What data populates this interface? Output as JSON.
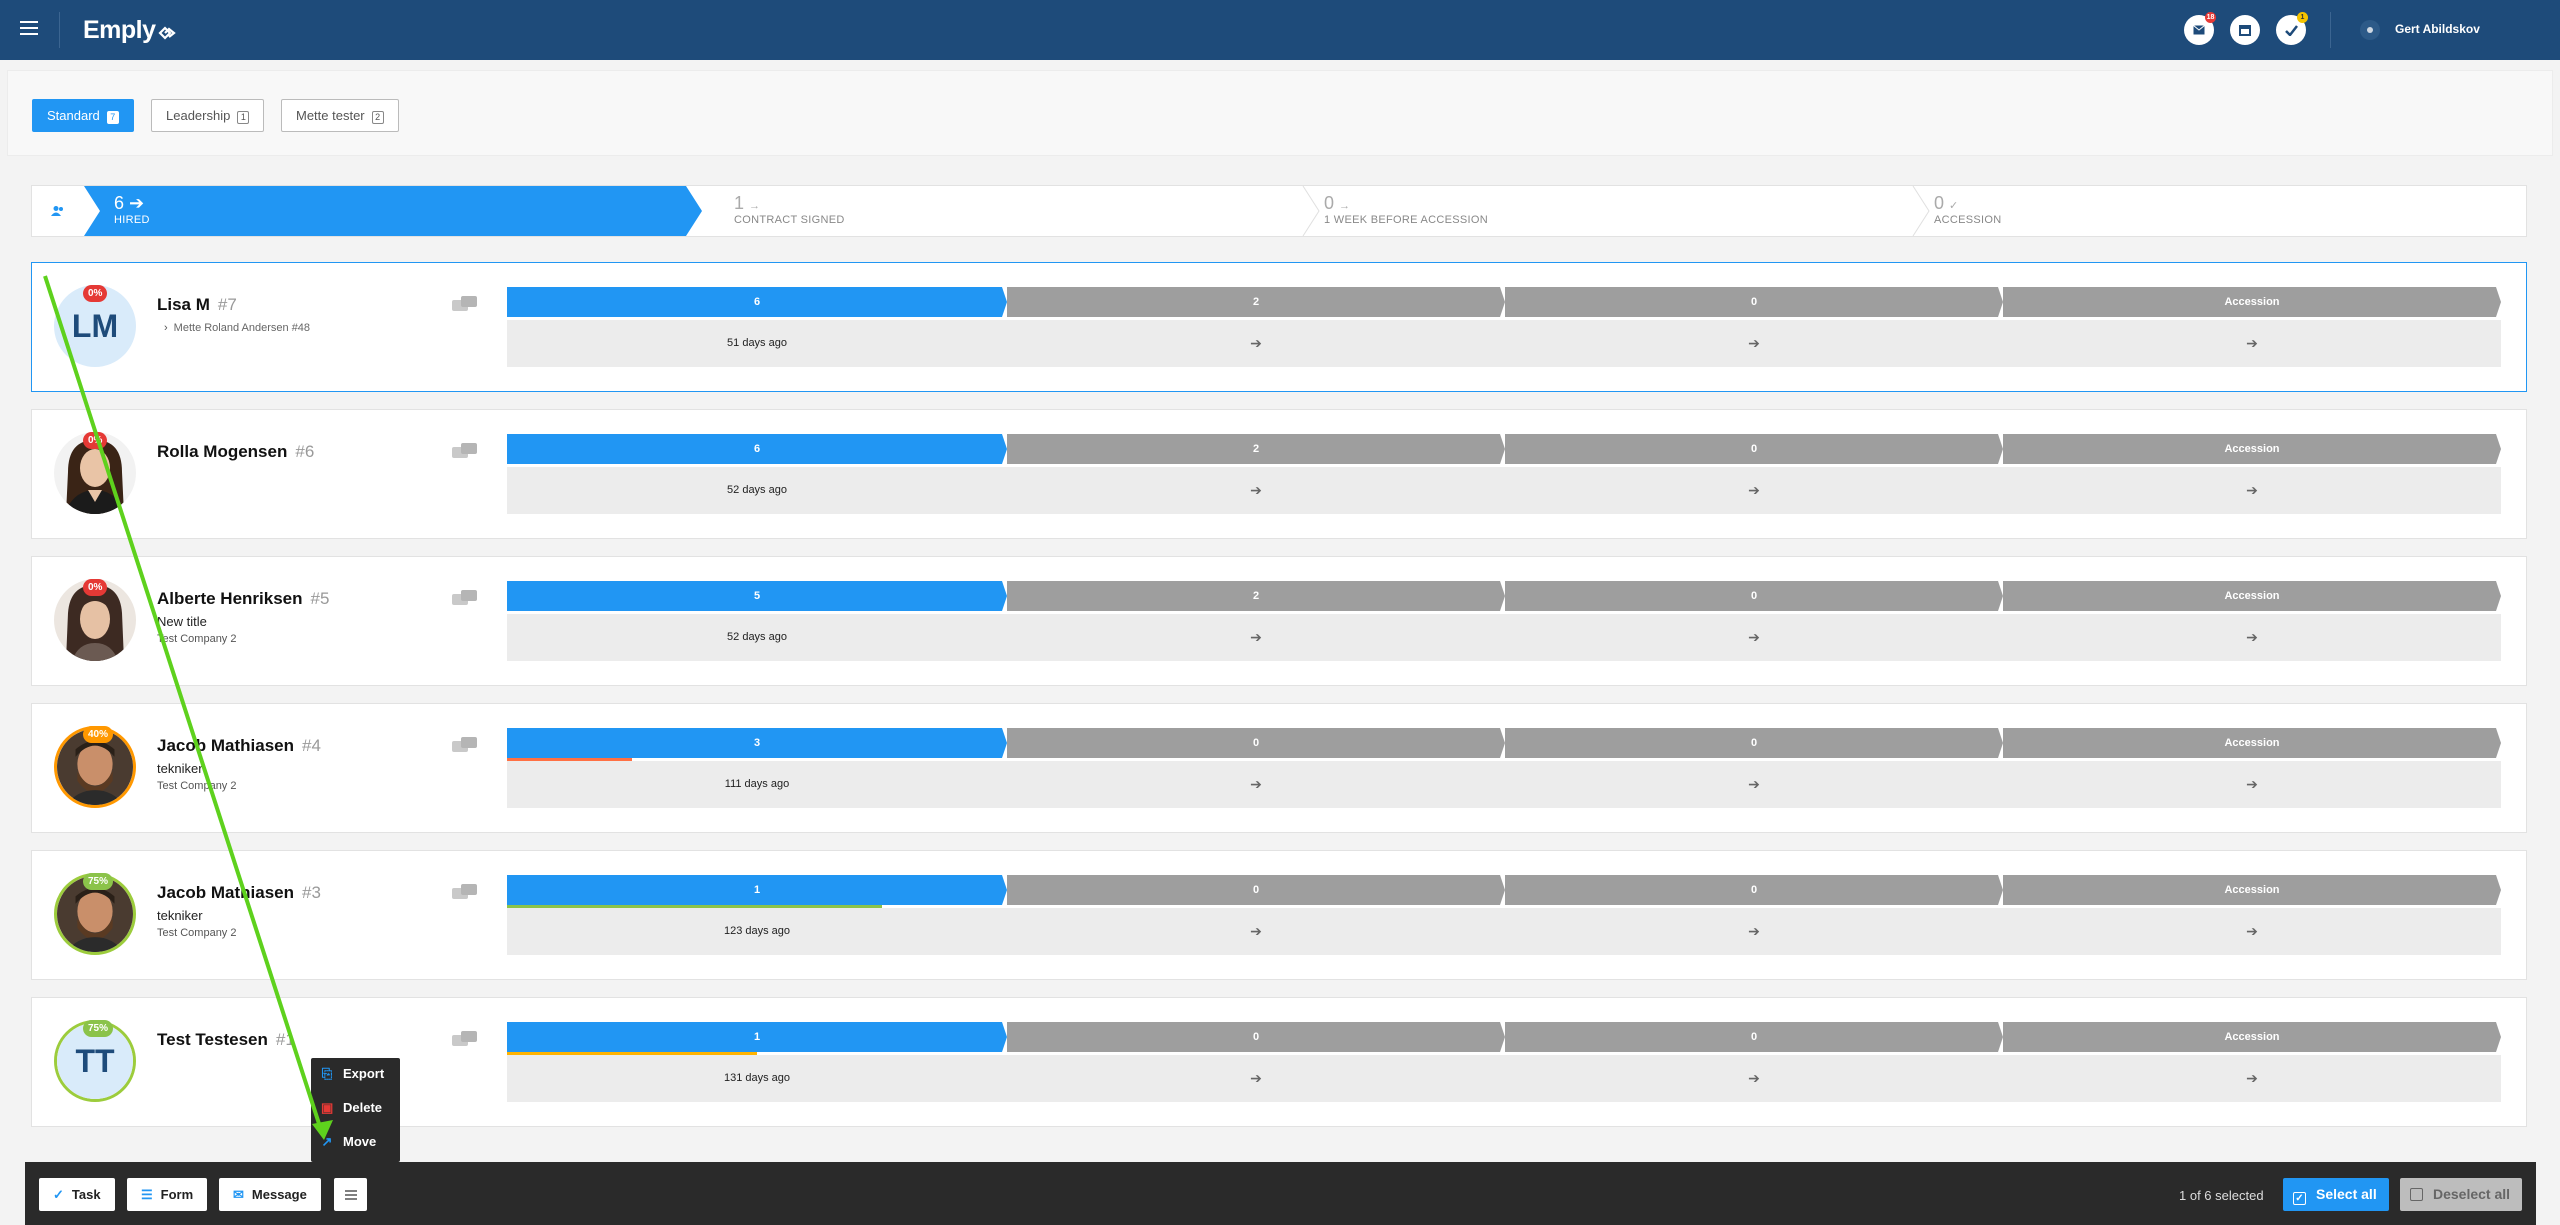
{
  "header": {
    "logo_text": "Emply",
    "user_name": "Gert Abildskov",
    "icons": [
      "menu-icon",
      "mail-icon",
      "calendar-icon",
      "check-icon",
      "user-avatar-icon"
    ],
    "mail_badge": "18",
    "task_badge": "1",
    "colors": {
      "bar": "#1e4b7a",
      "mail_badge": "#e53935",
      "task_badge": "#f5c400"
    }
  },
  "filters": [
    {
      "label": "Standard",
      "count": "7",
      "active": true
    },
    {
      "label": "Leadership",
      "count": "1",
      "active": false
    },
    {
      "label": "Mette tester",
      "count": "2",
      "active": false
    }
  ],
  "stages": [
    {
      "count": "6",
      "label": "HIRED",
      "icon": "arrow-right-icon",
      "active": true
    },
    {
      "count": "1",
      "label": "CONTRACT SIGNED",
      "icon": "arrow-right-icon",
      "active": false
    },
    {
      "count": "0",
      "label": "1 WEEK BEFORE ACCESSION",
      "icon": "arrow-right-icon",
      "active": false
    },
    {
      "count": "0",
      "label": "ACCESSION",
      "icon": "check-icon",
      "active": false
    }
  ],
  "candidates": [
    {
      "name": "Lisa M",
      "id": "#7",
      "initials": "LM",
      "percent": "0%",
      "title": "",
      "company": "",
      "reference": "Mette Roland Andersen #48",
      "selected": true,
      "cols": [
        {
          "top": "6",
          "bottom": "51 days ago"
        },
        {
          "top": "2",
          "bottom": "➔"
        },
        {
          "top": "0",
          "bottom": "➔"
        },
        {
          "top": "Accession",
          "bottom": "➔"
        }
      ],
      "progress": 0
    },
    {
      "name": "Rolla Mogensen",
      "id": "#6",
      "initials": "",
      "percent": "0%",
      "title": "",
      "company": "",
      "reference": "",
      "selected": false,
      "cols": [
        {
          "top": "6",
          "bottom": "52 days ago"
        },
        {
          "top": "2",
          "bottom": "➔"
        },
        {
          "top": "0",
          "bottom": "➔"
        },
        {
          "top": "Accession",
          "bottom": "➔"
        }
      ],
      "progress": 0
    },
    {
      "name": "Alberte Henriksen",
      "id": "#5",
      "initials": "",
      "percent": "0%",
      "title": "New title",
      "company": "Test Company 2",
      "reference": "",
      "selected": false,
      "cols": [
        {
          "top": "5",
          "bottom": "52 days ago"
        },
        {
          "top": "2",
          "bottom": "➔"
        },
        {
          "top": "0",
          "bottom": "➔"
        },
        {
          "top": "Accession",
          "bottom": "➔"
        }
      ],
      "progress": 0
    },
    {
      "name": "Jacob Mathiasen",
      "id": "#4",
      "initials": "",
      "percent": "40%",
      "title": "tekniker",
      "company": "Test Company 2",
      "reference": "",
      "selected": false,
      "cols": [
        {
          "top": "3",
          "bottom": "111 days ago"
        },
        {
          "top": "0",
          "bottom": "➔"
        },
        {
          "top": "0",
          "bottom": "➔"
        },
        {
          "top": "Accession",
          "bottom": "➔"
        }
      ],
      "progress": 0.25
    },
    {
      "name": "Jacob Mathiasen",
      "id": "#3",
      "initials": "",
      "percent": "75%",
      "title": "tekniker",
      "company": "Test Company 2",
      "reference": "",
      "selected": false,
      "cols": [
        {
          "top": "1",
          "bottom": "123 days ago"
        },
        {
          "top": "0",
          "bottom": "➔"
        },
        {
          "top": "0",
          "bottom": "➔"
        },
        {
          "top": "Accession",
          "bottom": "➔"
        }
      ],
      "progress": 0.75
    },
    {
      "name": "Test Testesen",
      "id": "#1",
      "initials": "TT",
      "percent": "75%",
      "title": "",
      "company": "",
      "reference": "",
      "selected": false,
      "cols": [
        {
          "top": "1",
          "bottom": "131 days ago"
        },
        {
          "top": "0",
          "bottom": "➔"
        },
        {
          "top": "0",
          "bottom": "➔"
        },
        {
          "top": "Accession",
          "bottom": "➔"
        }
      ],
      "progress": 0.5
    }
  ],
  "popup_menu": [
    {
      "label": "Export",
      "icon": "export-icon"
    },
    {
      "label": "Delete",
      "icon": "trash-icon"
    },
    {
      "label": "Move",
      "icon": "move-arrow-icon"
    }
  ],
  "bottom_bar": {
    "task_label": "Task",
    "form_label": "Form",
    "message_label": "Message",
    "selection_status": "1 of 6 selected",
    "select_all_label": "Select all",
    "deselect_all_label": "Deselect all"
  }
}
